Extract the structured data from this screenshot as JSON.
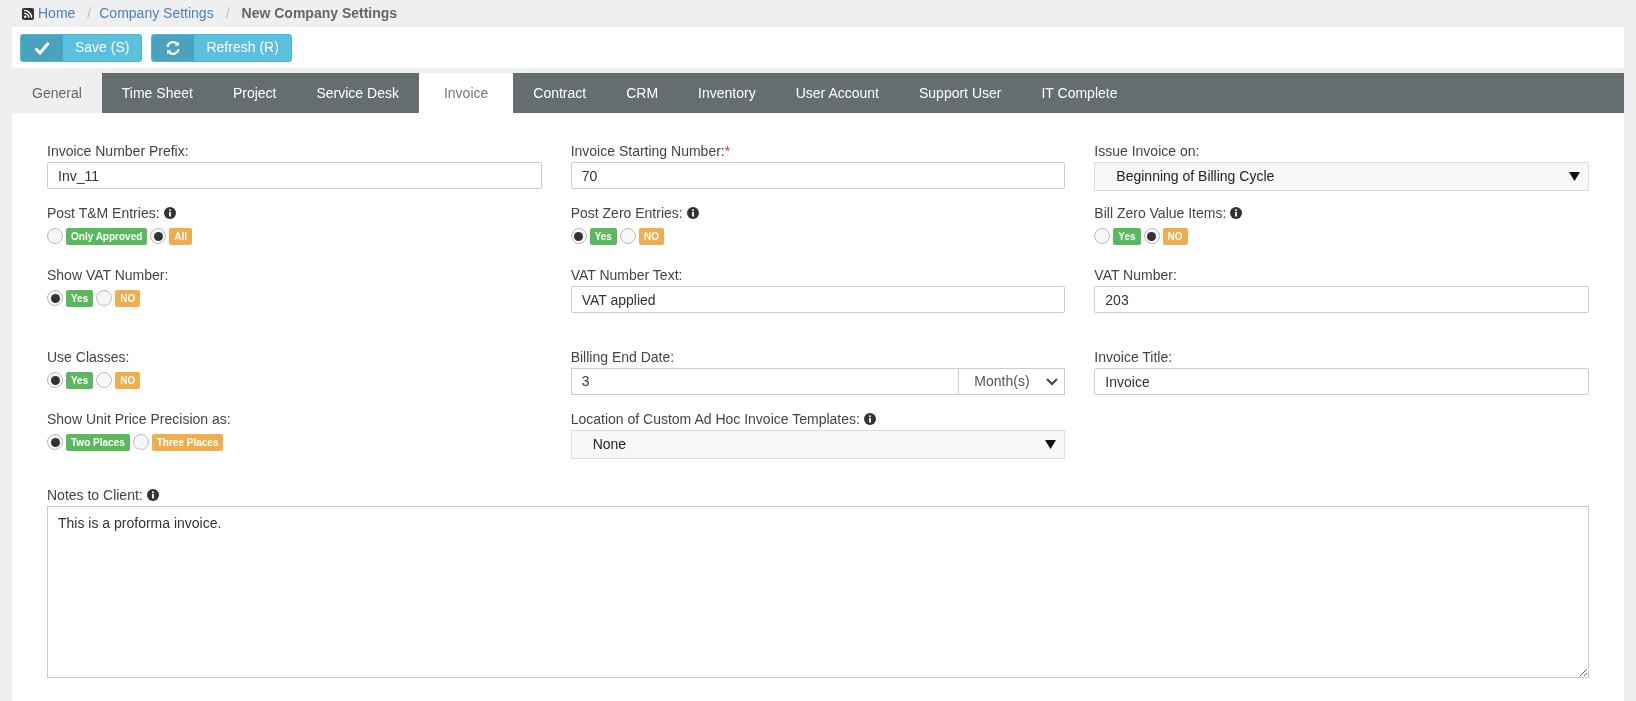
{
  "breadcrumb": [
    {
      "label": "Home",
      "link": true
    },
    {
      "label": "Company Settings",
      "link": true
    },
    {
      "label": "New Company Settings",
      "link": false
    }
  ],
  "breadcrumb_separator": "/",
  "toolbar": [
    {
      "label": "Save (S)"
    },
    {
      "label": "Refresh (R)"
    }
  ],
  "tabs": [
    {
      "label": "General",
      "selected": false
    },
    {
      "label": "Time Sheet",
      "selected": false
    },
    {
      "label": "Project",
      "selected": false
    },
    {
      "label": "Service Desk",
      "selected": false
    },
    {
      "label": "Invoice",
      "selected": true
    },
    {
      "label": "Contract",
      "selected": false
    },
    {
      "label": "CRM",
      "selected": false
    },
    {
      "label": "Inventory",
      "selected": false
    },
    {
      "label": "User Account",
      "selected": false
    },
    {
      "label": "Support User",
      "selected": false
    },
    {
      "label": "IT Complete",
      "selected": false
    }
  ],
  "form_rows": [
    [
      {
        "kind": "text",
        "label": "Invoice Number Prefix:",
        "value": "Inv_11"
      },
      {
        "kind": "text",
        "label": "Invoice Starting Number:",
        "required_mark": "*",
        "value": "70"
      },
      {
        "kind": "select",
        "label": "Issue Invoice on:",
        "value": "Beginning of Billing Cycle"
      }
    ],
    [
      {
        "kind": "radio",
        "label": "Post T&M Entries:",
        "info": true,
        "options": [
          {
            "label": "Only Approved",
            "selected": false,
            "color": "#5cb85c"
          },
          {
            "label": "All",
            "selected": true,
            "color": "#f0ad4e"
          }
        ]
      },
      {
        "kind": "radio",
        "label": "Post Zero Entries:",
        "info": true,
        "options": [
          {
            "label": "Yes",
            "selected": true,
            "color": "#5cb85c"
          },
          {
            "label": "NO",
            "selected": false,
            "color": "#f0ad4e"
          }
        ]
      },
      {
        "kind": "radio",
        "label": "Bill Zero Value Items:",
        "info": true,
        "options": [
          {
            "label": "Yes",
            "selected": false,
            "color": "#5cb85c"
          },
          {
            "label": "NO",
            "selected": true,
            "color": "#f0ad4e"
          }
        ]
      }
    ],
    [
      {
        "kind": "radio",
        "label": "Show VAT Number:",
        "options": [
          {
            "label": "Yes",
            "selected": true,
            "color": "#5cb85c"
          },
          {
            "label": "NO",
            "selected": false,
            "color": "#f0ad4e"
          }
        ]
      },
      {
        "kind": "text",
        "label": "VAT Number Text:",
        "value": "VAT applied"
      },
      {
        "kind": "text",
        "label": "VAT Number:",
        "value": "203"
      }
    ],
    [
      {
        "kind": "radio",
        "label": "Use Classes:",
        "options": [
          {
            "label": "Yes",
            "selected": true,
            "color": "#5cb85c"
          },
          {
            "label": "NO",
            "selected": false,
            "color": "#f0ad4e"
          }
        ]
      },
      {
        "kind": "split",
        "label": "Billing End Date:",
        "value": "3",
        "unit": "Month(s)"
      },
      {
        "kind": "text",
        "label": "Invoice Title:",
        "value": "Invoice"
      }
    ],
    [
      {
        "kind": "radio",
        "label": "Show Unit Price Precision as:",
        "options": [
          {
            "label": "Two Places",
            "selected": true,
            "color": "#5cb85c"
          },
          {
            "label": "Three Places",
            "selected": false,
            "color": "#f0ad4e"
          }
        ]
      },
      {
        "kind": "select",
        "label": "Location of Custom Ad Hoc Invoice Templates:",
        "info": true,
        "value": "None"
      }
    ]
  ],
  "notes": {
    "label": "Notes to Client:",
    "info": true,
    "value": "This is a proforma invoice."
  }
}
